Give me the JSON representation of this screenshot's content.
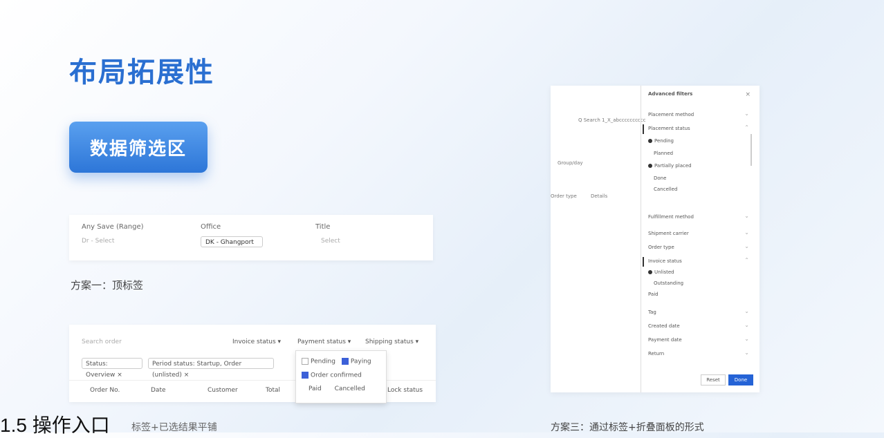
{
  "title": "布局拓展性",
  "badge": "数据筛选区",
  "card1": {
    "labels": [
      "Any Save (Range)",
      "Office",
      "Title"
    ],
    "values": [
      "Dr - Select",
      "DK - Ghangport",
      "Select"
    ]
  },
  "caption1": "方案一：顶标签",
  "card2": {
    "search_placeholder": "Search order",
    "dropdowns": [
      "Invoice status ▾",
      "Payment status ▾",
      "Shipping status ▾"
    ],
    "filters": [
      "Status: Overview ×",
      "Period status: Startup, Order (unlisted) ×"
    ],
    "columns": [
      "Order No.",
      "Date",
      "Customer",
      "Total",
      "Lock status"
    ],
    "popup_items": [
      "Pending",
      "Paying",
      "Order confirmed",
      "Paid",
      "Cancelled"
    ]
  },
  "heading_big": "1.5 操作入口",
  "heading_small": "标签+已选结果平铺",
  "caption2": "方案三：通过标签+折叠面板的形式",
  "shot": {
    "left_texts": [
      "Q Search 1_X_abcccccccccc",
      "Group/day",
      "Order type",
      "Details"
    ],
    "panel_title": "Advanced filters",
    "panel_items": [
      "Placement method",
      "Placement status",
      "Pending",
      "Planned",
      "Partially placed",
      "Done",
      "Cancelled",
      "Fulfillment method",
      "Shipment carrier",
      "Order type",
      "Invoice status",
      "Unlisted",
      "Outstanding",
      "Paid",
      "Tag",
      "Created date",
      "Payment date",
      "Return"
    ],
    "reset_label": "Reset",
    "done_label": "Done"
  }
}
